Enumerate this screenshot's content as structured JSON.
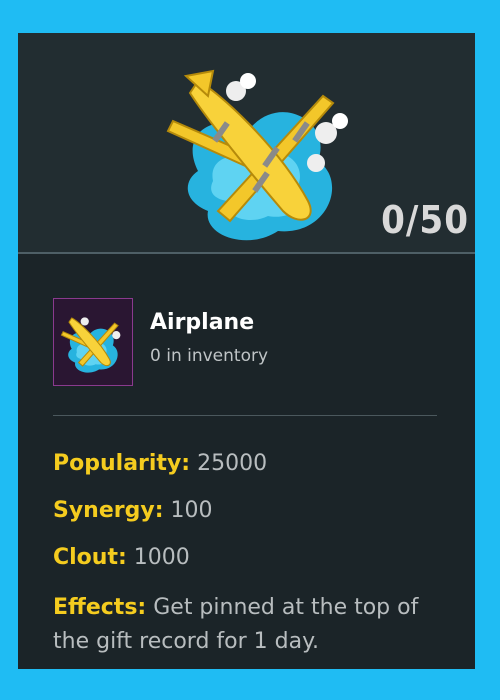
{
  "hero": {
    "counter": "0/50",
    "art_icon": "airplane-gift-icon"
  },
  "item": {
    "name": "Airplane",
    "inventory": "0 in inventory",
    "thumb_icon": "airplane-gift-icon"
  },
  "stats": {
    "popularity_label": "Popularity:",
    "popularity_value": "25000",
    "synergy_label": "Synergy:",
    "synergy_value": "100",
    "clout_label": "Clout:",
    "clout_value": "1000",
    "effects_label": "Effects:",
    "effects_value": "Get pinned at the top of the gift record for 1 day."
  },
  "colors": {
    "frame": "#1fbcf3",
    "panel": "#1b2428",
    "stat_key": "#f5cc1f",
    "stat_value": "#b8bdbf",
    "thumb_border": "#8a3a8e"
  }
}
